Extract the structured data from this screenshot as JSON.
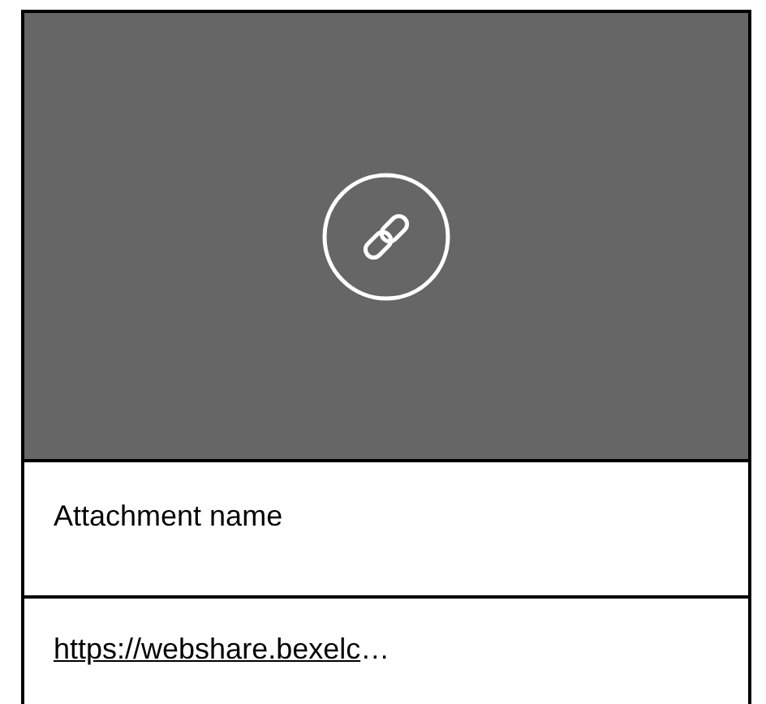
{
  "attachment": {
    "name": "Attachment name",
    "url": "https://webshare.bexelc",
    "url_ellipsis": "…"
  }
}
